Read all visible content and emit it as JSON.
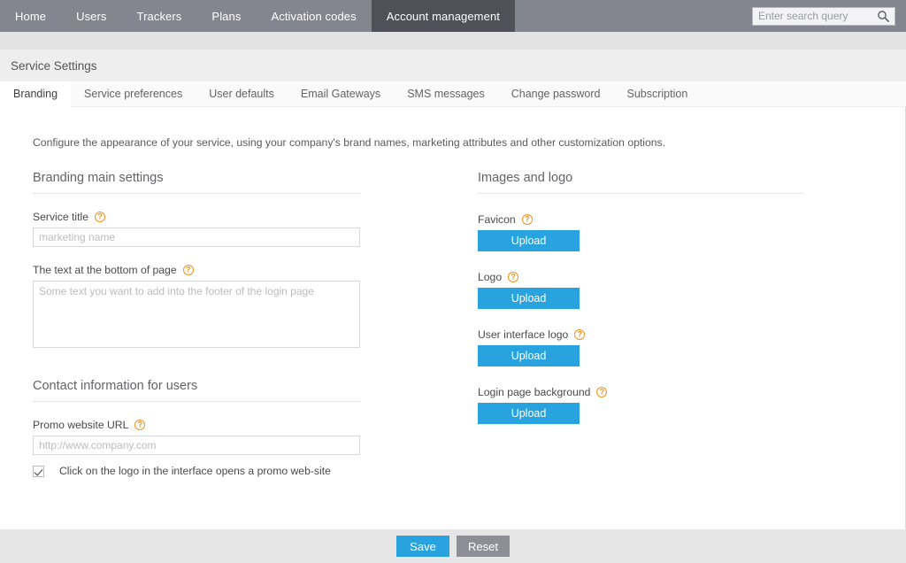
{
  "topnav": {
    "items": [
      {
        "label": "Home",
        "active": false
      },
      {
        "label": "Users",
        "active": false
      },
      {
        "label": "Trackers",
        "active": false
      },
      {
        "label": "Plans",
        "active": false
      },
      {
        "label": "Activation codes",
        "active": false
      },
      {
        "label": "Account management",
        "active": true
      }
    ],
    "search": {
      "placeholder": "Enter search query",
      "value": "",
      "icon": "search-icon"
    },
    "colors": {
      "bar": "#83858f",
      "active_tab": "#4f5058"
    }
  },
  "header": {
    "title": "Service Settings"
  },
  "tabs": [
    {
      "label": "Branding",
      "active": true
    },
    {
      "label": "Service preferences",
      "active": false
    },
    {
      "label": "User defaults",
      "active": false
    },
    {
      "label": "Email Gateways",
      "active": false
    },
    {
      "label": "SMS messages",
      "active": false
    },
    {
      "label": "Change password",
      "active": false
    },
    {
      "label": "Subscription",
      "active": false
    }
  ],
  "content": {
    "intro": "Configure the appearance of your service, using your company's brand names, marketing attributes and other customization options.",
    "left": {
      "section_title": "Branding main settings",
      "service_title": {
        "label": "Service title",
        "help_icon": "question-mark-icon",
        "placeholder": "marketing name",
        "value": ""
      },
      "footer_text": {
        "label": "The text at the bottom of page",
        "help_icon": "question-mark-icon",
        "placeholder": "Some text you want to add into the footer of the login page",
        "value": ""
      },
      "contact_section_title": "Contact information for users",
      "promo_url": {
        "label": "Promo website URL",
        "help_icon": "question-mark-icon",
        "placeholder": "http://www.company.com",
        "value": ""
      },
      "promo_checkbox": {
        "label": "Click on the logo in the interface opens a promo web-site",
        "checked": true
      }
    },
    "right": {
      "section_title": "Images and logo",
      "uploads": [
        {
          "label": "Favicon",
          "help_icon": "question-mark-icon",
          "button": "Upload"
        },
        {
          "label": "Logo",
          "help_icon": "question-mark-icon",
          "button": "Upload"
        },
        {
          "label": "User interface logo",
          "help_icon": "question-mark-icon",
          "button": "Upload"
        },
        {
          "label": "Login page background",
          "help_icon": "question-mark-icon",
          "button": "Upload"
        }
      ]
    }
  },
  "footer": {
    "save_label": "Save",
    "reset_label": "Reset",
    "colors": {
      "primary": "#29a3e0",
      "secondary": "#8e8e96"
    }
  }
}
